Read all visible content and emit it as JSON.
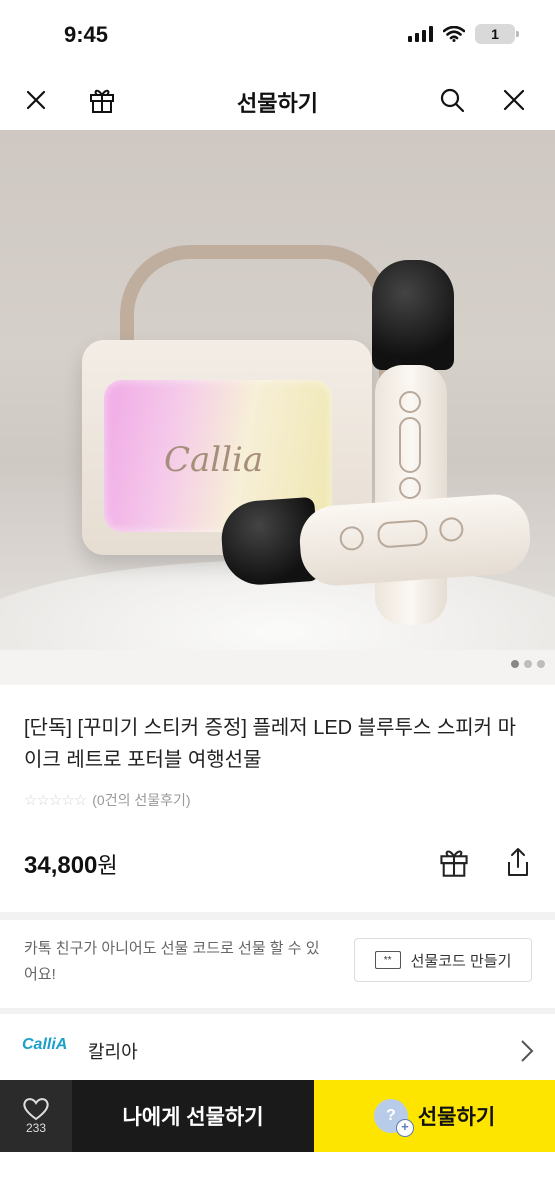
{
  "status": {
    "time": "9:45",
    "battery": "1"
  },
  "nav": {
    "title": "선물하기",
    "icons": [
      "close-icon",
      "gift-icon",
      "search-icon",
      "close-icon"
    ]
  },
  "hero": {
    "brand_text": "Callia",
    "page_count": 3,
    "current_page": 1
  },
  "product": {
    "title": "[단독] [꾸미기 스티커 증정] 플레저 LED 블루투스 스피커 마이크 레트로 포터블 여행선물",
    "stars": "☆☆☆☆☆",
    "review_text": "(0건의 선물후기)",
    "price": "34,800",
    "price_unit": "원"
  },
  "gift_code": {
    "description": "카톡 친구가 아니어도 선물 코드로 선물 할 수 있어요!",
    "button_label": "선물코드 만들기",
    "button_icon": "**"
  },
  "brand": {
    "logo_text": "CalliA",
    "name": "칼리아"
  },
  "bottom": {
    "like_count": "233",
    "self_gift_label": "나에게 선물하기",
    "gift_label": "선물하기",
    "gift_icon_glyph": "?",
    "gift_icon_plus": "+"
  },
  "colors": {
    "accent": "#fee500",
    "dark": "#1a1a1a"
  }
}
